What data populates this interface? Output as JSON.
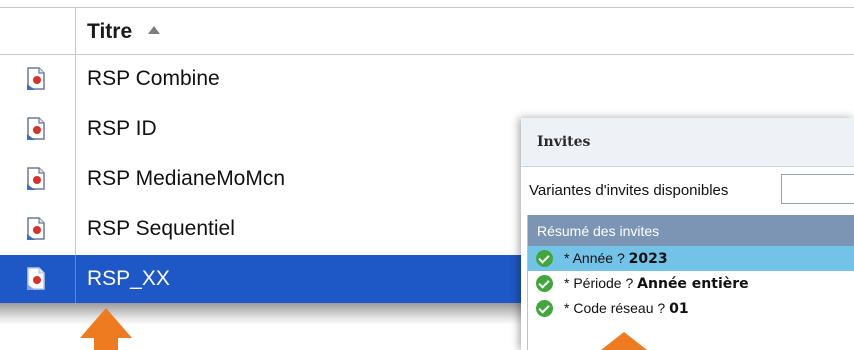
{
  "list": {
    "header": "Titre",
    "items": [
      {
        "label": "RSP Combine",
        "selected": false
      },
      {
        "label": "RSP ID",
        "selected": false
      },
      {
        "label": "RSP MedianeMoMcn",
        "selected": false
      },
      {
        "label": "RSP Sequentiel",
        "selected": false
      },
      {
        "label": "RSP_XX",
        "selected": true
      }
    ]
  },
  "dialog": {
    "title": "Invites",
    "variants_label": "Variantes d'invites disponibles",
    "variants_value": "",
    "summary_title": "Résumé des invites",
    "prompts": [
      {
        "label": "* Année ? ",
        "value": "2023",
        "highlighted": true
      },
      {
        "label": "* Période ? ",
        "value": "Année entière",
        "highlighted": false
      },
      {
        "label": "* Code réseau ? ",
        "value": "01",
        "highlighted": false
      }
    ]
  },
  "colors": {
    "selected_row": "#1e57c6",
    "dialog_header": "#7c95b4",
    "highlight_row": "#73c3e8",
    "check": "#43a63c",
    "arrow": "#ee7b1f"
  }
}
